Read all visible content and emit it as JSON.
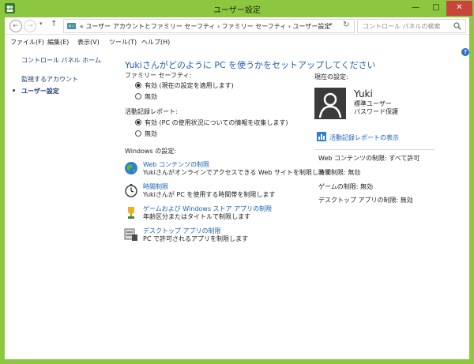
{
  "window": {
    "title": "ユーザー設定",
    "minimize_glyph": "—",
    "maximize_glyph": "□",
    "close_glyph": "✕",
    "accent": "#8dc63f",
    "close_color": "#c7453a"
  },
  "nav": {
    "back_glyph": "←",
    "forward_glyph": "→",
    "dropdown_glyph": "▾",
    "up_glyph": "↑",
    "address_text": "« ユーザー アカウントとファミリー セーフティ  ›  ファミリー セーフティ  ›  ユーザー設定",
    "address_dropdown_glyph": "▾",
    "refresh_glyph": "↻",
    "search_placeholder": "コントロール パネルの検索"
  },
  "menu": {
    "file": "ファイル(F)",
    "edit": "編集(E)",
    "view": "表示(V)",
    "tools": "ツール(T)",
    "help": "ヘルプ(H)"
  },
  "help_glyph": "?",
  "sidebar": {
    "home": "コントロール パネル ホーム",
    "monitor": "監視するアカウント",
    "current": "ユーザー設定"
  },
  "main": {
    "heading": "Yukiさんがどのように PC を使うかをセットアップしてください",
    "family_safety": {
      "label": "ファミリー セーフティ:",
      "on": "有効 (現在の設定を適用します)",
      "off": "無効"
    },
    "activity_report": {
      "label": "活動記録レポート:",
      "on": "有効 (PC の使用状況についての情報を収集します)",
      "off": "無効"
    },
    "windows_settings_label": "Windows の設定:",
    "tasks": [
      {
        "title": "Web コンテンツの制限",
        "desc": "Yukiさんがオンラインでアクセスできる Web サイトを制限します",
        "icon": "globe-icon"
      },
      {
        "title": "時間制限",
        "desc": "Yukiさんが PC を使用する時間帯を制限します",
        "icon": "clock-icon"
      },
      {
        "title": "ゲームおよび Windows ストア アプリの制限",
        "desc": "年齢区分またはタイトルで制限します",
        "icon": "trophy-icon"
      },
      {
        "title": "デスクトップ アプリの制限",
        "desc": "PC で許可されるアプリを制限します",
        "icon": "desktop-app-icon"
      }
    ]
  },
  "current_settings": {
    "label": "現在の設定:",
    "user_name": "Yuki",
    "account_type": "標準ユーザー",
    "password_state": "パスワード保護",
    "activity_link": "活動記録レポートの表示",
    "summary": [
      "Web コンテンツの制限: すべて許可",
      "時間制限: 無効",
      "ゲームの制限: 無効",
      "デスクトップ アプリの制限: 無効"
    ]
  }
}
